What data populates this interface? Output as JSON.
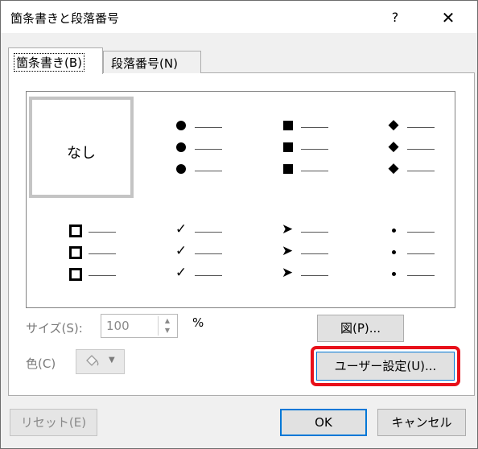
{
  "window": {
    "title": "箇条書きと段落番号",
    "help_label": "?",
    "close_label": "✕"
  },
  "tabs": [
    {
      "label": "箇条書き(B)",
      "selected": true
    },
    {
      "label": "段落番号(N)",
      "selected": false
    }
  ],
  "gallery": {
    "none_label": "なし",
    "bullet_symbols": {
      "filled_circle": "●",
      "filled_square": "■",
      "diamond": "◆",
      "hollow_square": "□",
      "check": "✓",
      "arrow": "➤",
      "small_dot": "•"
    }
  },
  "size": {
    "label": "サイズ(S):",
    "value": "100",
    "unit": "%",
    "spin_up": "▲",
    "spin_down": "▼"
  },
  "color": {
    "label": "色(C)",
    "icon": "paint-bucket-icon",
    "caret": "▼"
  },
  "buttons": {
    "picture": "図(P)...",
    "customize": "ユーザー設定(U)...",
    "reset": "リセット(E)",
    "ok": "OK",
    "cancel": "キャンセル"
  },
  "colors": {
    "highlight": "#e8101a",
    "focus": "#0078d7"
  }
}
